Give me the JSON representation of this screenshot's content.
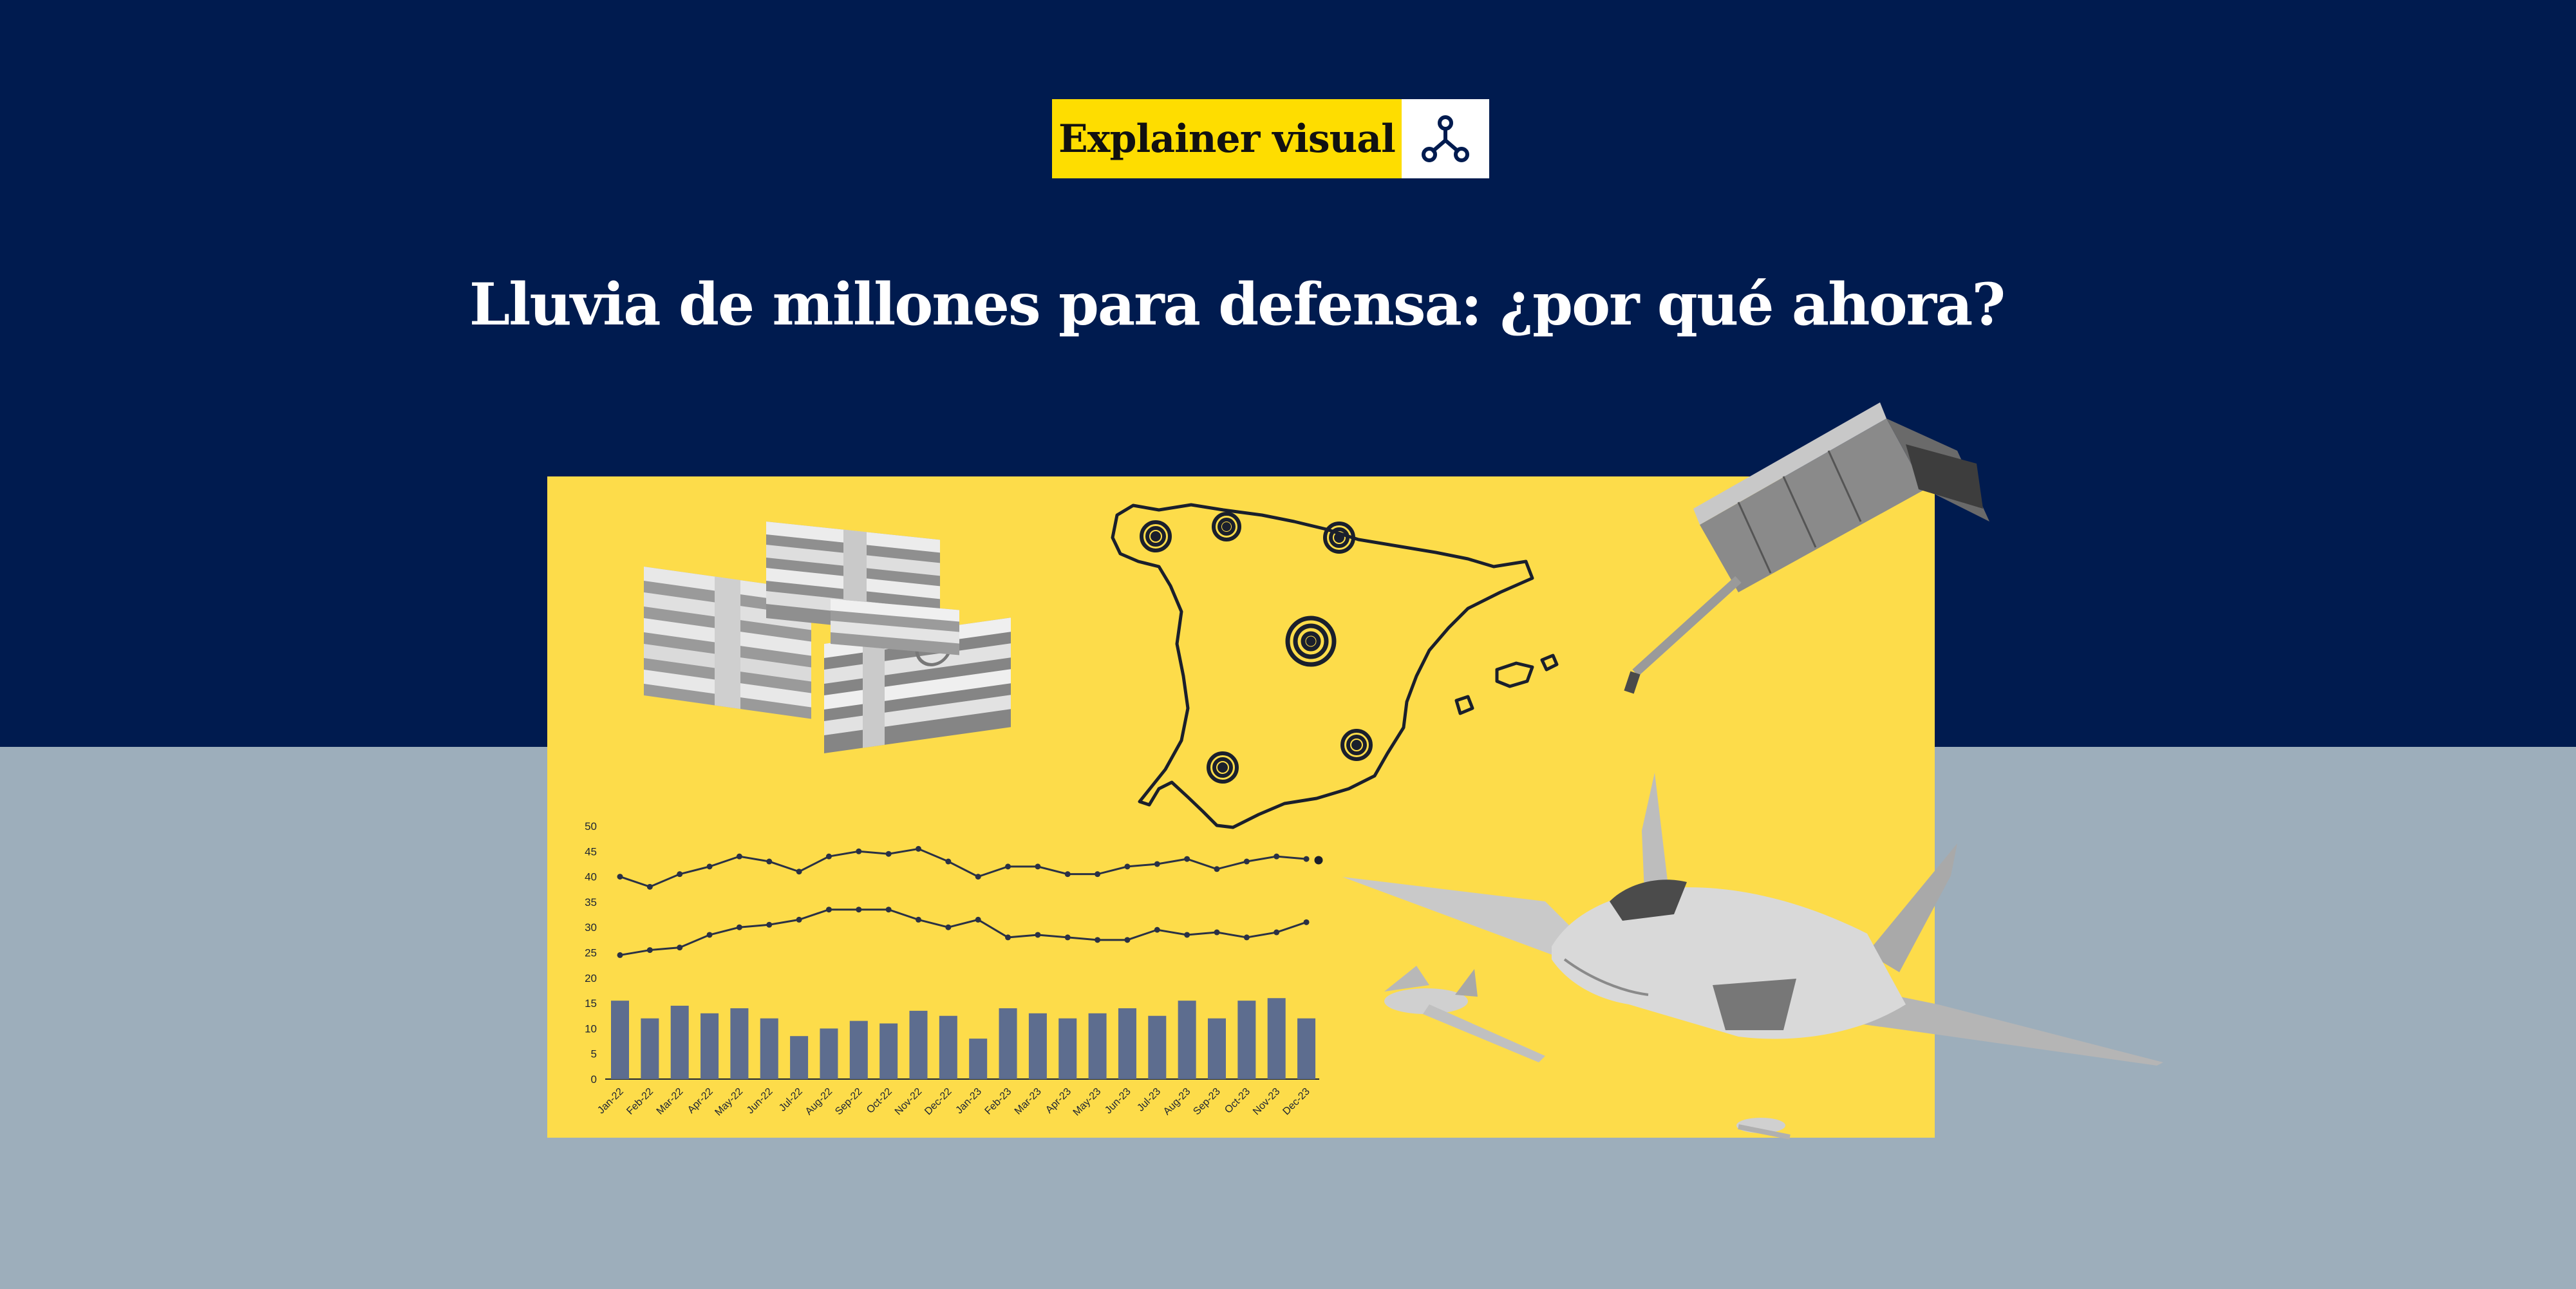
{
  "badge": {
    "label": "Explainer visual",
    "icon": "share-nodes-icon"
  },
  "title": "Lluvia de millones para defensa: ¿por qué ahora?",
  "colors": {
    "navy": "#001b4f",
    "slate": "#9daebb",
    "yellow": "#fddc4a",
    "badge_yellow": "#fedd00",
    "bars": "#5d6d8f",
    "ink": "#1c2333"
  },
  "illustrations": [
    "euro-banknote-stacks",
    "spain-map-with-targets",
    "satellite",
    "fighter-jet",
    "drones"
  ],
  "chart_data": {
    "type": "bar",
    "categories": [
      "Jan-22",
      "Feb-22",
      "Mar-22",
      "Apr-22",
      "May-22",
      "Jun-22",
      "Jul-22",
      "Aug-22",
      "Sep-22",
      "Oct-22",
      "Nov-22",
      "Dec-22",
      "Jan-23",
      "Feb-23",
      "Mar-23",
      "Apr-23",
      "May-23",
      "Jun-23",
      "Jul-23",
      "Aug-23",
      "Sep-23",
      "Oct-23",
      "Nov-23",
      "Dec-23"
    ],
    "values": [
      15.5,
      12,
      14.5,
      13,
      14,
      12,
      8.5,
      10,
      11.5,
      11,
      13.5,
      12.5,
      8,
      14,
      13,
      12,
      13,
      14,
      12.5,
      15.5,
      12,
      15.5,
      16,
      12
    ],
    "lines": [
      {
        "values": [
          40,
          38,
          40.5,
          42,
          44,
          43,
          41,
          44,
          45,
          44.5,
          45.5,
          43,
          40,
          42,
          42,
          40.5,
          40.5,
          42,
          42.5,
          43.5,
          41.5,
          43,
          44,
          43.5
        ]
      },
      {
        "values": [
          24.5,
          25.5,
          26,
          28.5,
          30,
          30.5,
          31.5,
          33.5,
          33.5,
          33.5,
          31.5,
          30,
          31.5,
          28,
          28.5,
          28,
          27.5,
          27.5,
          29.5,
          28.5,
          29,
          28,
          29,
          31
        ]
      }
    ],
    "yticks": [
      0,
      5,
      10,
      15,
      20,
      25,
      30,
      35,
      40,
      45,
      50
    ],
    "ylim": [
      0,
      50
    ]
  }
}
